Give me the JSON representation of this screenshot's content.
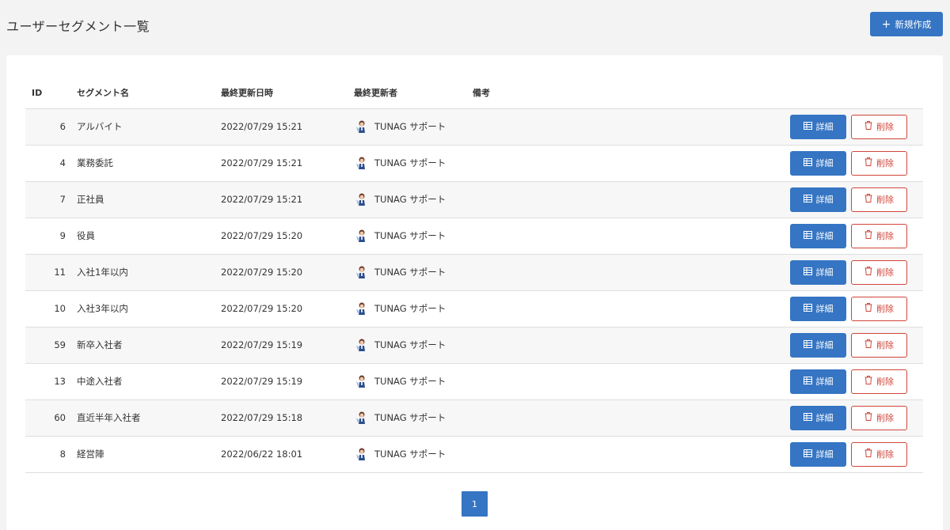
{
  "header": {
    "title": "ユーザーセグメント一覧",
    "new_button_label": "新規作成"
  },
  "table": {
    "columns": {
      "id": "ID",
      "name": "セグメント名",
      "updated_at": "最終更新日時",
      "updated_by": "最終更新者",
      "note": "備考"
    },
    "rows": [
      {
        "id": "6",
        "name": "アルバイト",
        "updated_at": "2022/07/29 15:21",
        "updated_by": "TUNAG サポート",
        "note": ""
      },
      {
        "id": "4",
        "name": "業務委託",
        "updated_at": "2022/07/29 15:21",
        "updated_by": "TUNAG サポート",
        "note": ""
      },
      {
        "id": "7",
        "name": "正社員",
        "updated_at": "2022/07/29 15:21",
        "updated_by": "TUNAG サポート",
        "note": ""
      },
      {
        "id": "9",
        "name": "役員",
        "updated_at": "2022/07/29 15:20",
        "updated_by": "TUNAG サポート",
        "note": ""
      },
      {
        "id": "11",
        "name": "入社1年以内",
        "updated_at": "2022/07/29 15:20",
        "updated_by": "TUNAG サポート",
        "note": ""
      },
      {
        "id": "10",
        "name": "入社3年以内",
        "updated_at": "2022/07/29 15:20",
        "updated_by": "TUNAG サポート",
        "note": ""
      },
      {
        "id": "59",
        "name": "新卒入社者",
        "updated_at": "2022/07/29 15:19",
        "updated_by": "TUNAG サポート",
        "note": ""
      },
      {
        "id": "13",
        "name": "中途入社者",
        "updated_at": "2022/07/29 15:19",
        "updated_by": "TUNAG サポート",
        "note": ""
      },
      {
        "id": "60",
        "name": "直近半年入社者",
        "updated_at": "2022/07/29 15:18",
        "updated_by": "TUNAG サポート",
        "note": ""
      },
      {
        "id": "8",
        "name": "経営陣",
        "updated_at": "2022/06/22 18:01",
        "updated_by": "TUNAG サポート",
        "note": ""
      }
    ],
    "detail_label": "詳細",
    "delete_label": "削除"
  },
  "pagination": {
    "current_page": "1"
  },
  "colors": {
    "primary": "#3575c3",
    "danger": "#d0453a",
    "row_stripe": "#f7f7f7",
    "background": "#f3f3f4"
  }
}
